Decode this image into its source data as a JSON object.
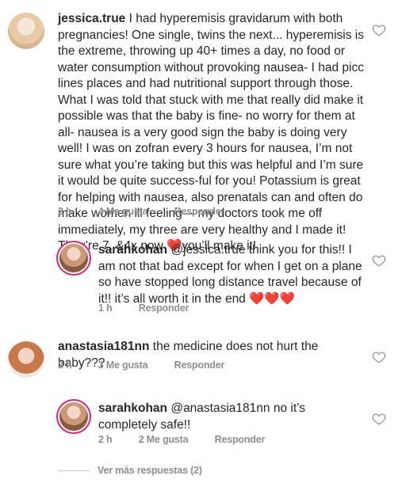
{
  "comments": [
    {
      "username": "jessica.true",
      "text": "I had hyperemisis gravidarum with both pregnancies! One single, twins the next... hyperemisis is the extreme, throwing up 40+ times a day, no food or water consumption without provoking nausea- I had picc lines places and had nutritional support through those. What I was told that stuck with me that really did make it possible was that the baby is fine- no worry for them at all- nausea is a very good sign the baby is doing very well! I was on zofran every 3 hours for nausea, I’m not sure what you’re taking but this was helpful and I’m sure it would be quite success-ful for you! Potassium is great for helping with nausea, also prenatals can and often do make women ill feeling— my doctors took me off immediately, my three are very healthy and I made it! They’re 7, &4x now ❤️you’ll make it!",
      "time": "2 h",
      "likes": "4 Me gusta",
      "reply": "Responder"
    },
    {
      "username": "sarahkohan",
      "text": "@jessica.true think you for this!! I am not that bad except for when I get on a plane so have stopped long distance travel because of it!! it’s all worth it in the end ❤️❤️❤️",
      "time": "1 h",
      "reply": "Responder"
    },
    {
      "username": "anastasia181nn",
      "text": "the medicine does not hurt the baby???",
      "time": "2 h",
      "likes": "3 Me gusta",
      "reply": "Responder"
    },
    {
      "username": "sarahkohan",
      "text": "@anastasia181nn no it’s completely safe!!",
      "time": "2 h",
      "likes": "2 Me gusta",
      "reply": "Responder"
    }
  ],
  "more_replies": "Ver más respuestas (2)",
  "icons": {
    "like": "heart-outline-icon"
  },
  "colors": {
    "text": "#262626",
    "meta": "#8e8e8e",
    "story_ring": "#d62976"
  }
}
